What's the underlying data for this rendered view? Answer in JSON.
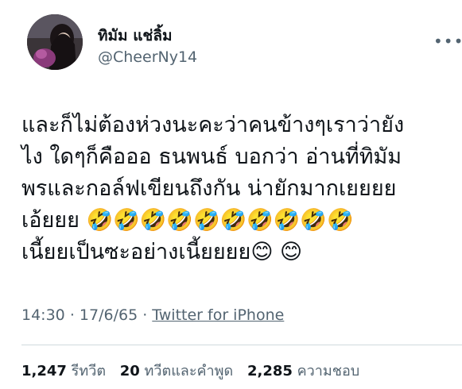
{
  "user": {
    "display_name": "ทิมัม แช่ลิ้ม",
    "handle": "@CheerNy14"
  },
  "tweet": {
    "text": "และก็ไม่ต้องห่วงนะคะว่าคนข้างๆเราว่ายัง\nไง ใดๆก็คือออ ธนพนธ์ บอกว่า อ่านที่ทิมัม\nพรและกอล์ฟเขียนถึงกัน น่ายักมากเยยยย\nเอ้ยยย 🤣🤣🤣🤣🤣🤣🤣🤣🤣🤣\nเนี้ยยเป็นซะอย่างเนี้ยยยย😊 😊",
    "time": "14:30",
    "date": "17/6/65",
    "source": "Twitter for iPhone"
  },
  "stats": {
    "retweets_count": "1,247",
    "retweets_label": "รีทวีต",
    "quotes_count": "20",
    "quotes_label": "ทวีตและคำพูด",
    "likes_count": "2,285",
    "likes_label": "ความชอบ"
  },
  "icons": {
    "more": "more-horizontal-icon"
  }
}
